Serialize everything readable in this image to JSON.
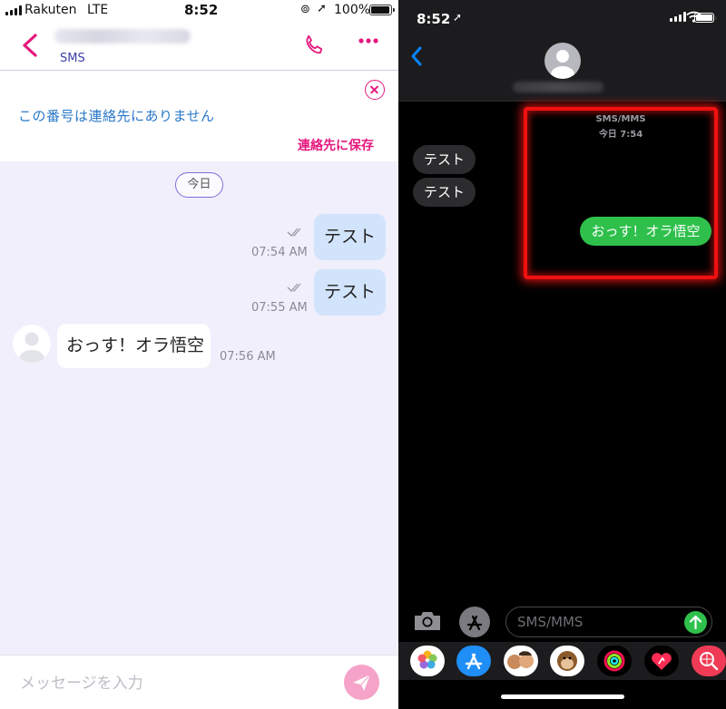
{
  "left": {
    "status": {
      "carrier": "Rakuten",
      "network": "LTE",
      "time": "8:52",
      "battery": "100%",
      "battery_level": 1.0
    },
    "header": {
      "subtitle": "SMS",
      "back_icon": "chevron-left-icon",
      "call_icon": "phone-icon",
      "more_icon": "more-dots-icon"
    },
    "notice": {
      "message": "この番号は連絡先にありません",
      "save_label": "連絡先に保存",
      "close_icon": "close-circle-icon"
    },
    "date_label": "今日",
    "messages_out": [
      {
        "text": "テスト",
        "time": "07:54 AM"
      },
      {
        "text": "テスト",
        "time": "07:55 AM"
      }
    ],
    "message_in": {
      "text": "おっす！オラ悟空",
      "time": "07:56 AM"
    },
    "compose": {
      "placeholder": "メッセージを入力",
      "send_icon": "paper-plane-icon"
    },
    "colors": {
      "accent": "#e5187e",
      "bubble_out": "#d2e4fb",
      "background": "#f0effb",
      "link": "#2a78c8"
    }
  },
  "right": {
    "status": {
      "time": "8:52"
    },
    "thread_meta": {
      "service": "SMS/MMS",
      "time": "今日 7:54"
    },
    "messages_in": [
      "テスト",
      "テスト"
    ],
    "message_out": "おっす！オラ悟空",
    "compose": {
      "placeholder": "SMS/MMS"
    },
    "apps": [
      "photos-icon",
      "app-store-icon",
      "memoji-icon",
      "animoji-monkey-icon",
      "activity-icon",
      "digital-touch-icon",
      "web-search-icon"
    ],
    "colors": {
      "sent_bubble": "#2fc04c",
      "received_bubble": "#2c2c2e",
      "highlight": "#f01010",
      "link": "#0a84ff"
    }
  }
}
